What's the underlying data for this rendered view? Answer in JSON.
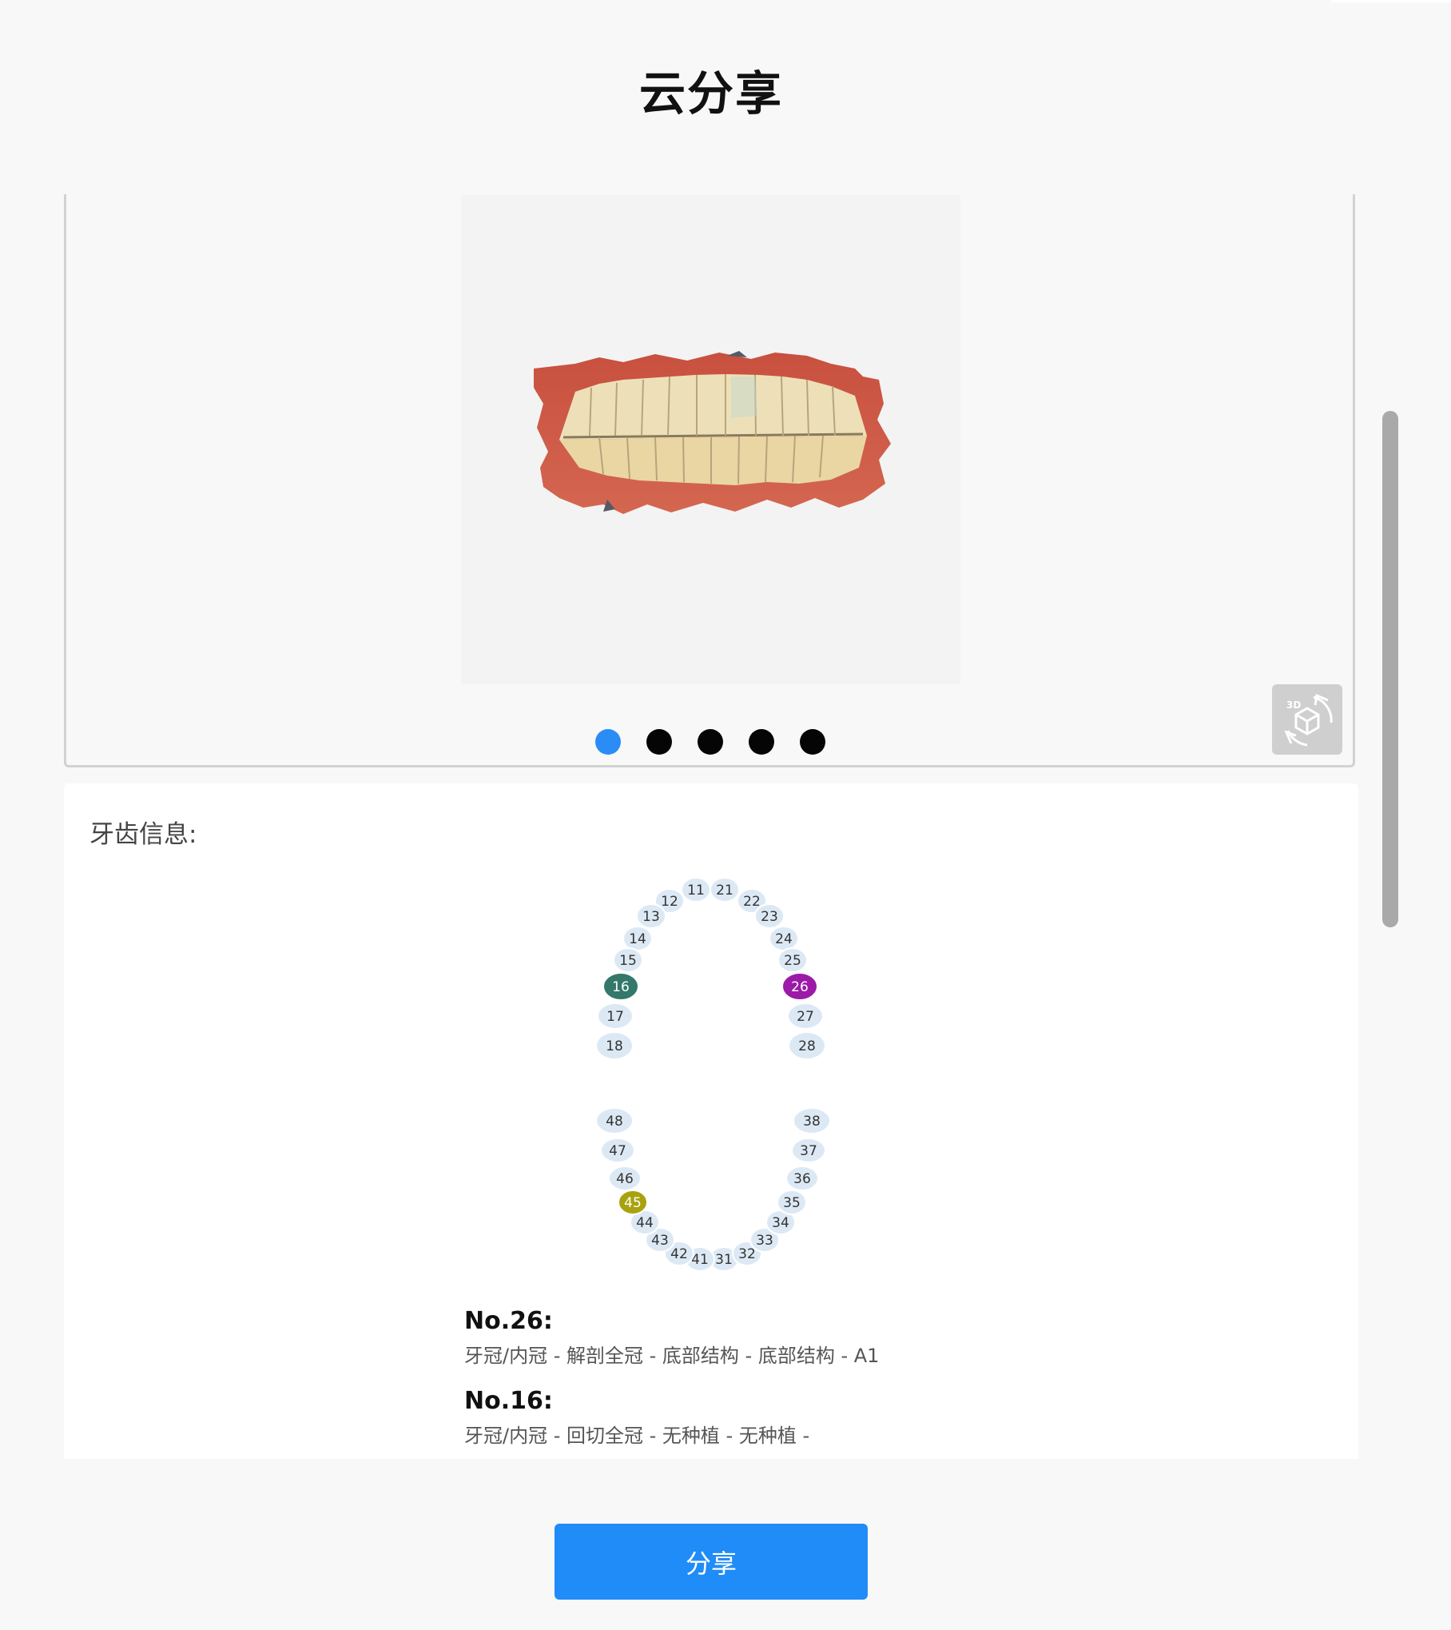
{
  "header": {
    "title": "云分享"
  },
  "viewer": {
    "dots": [
      true,
      false,
      false,
      false,
      false
    ],
    "view3d_label": "3D"
  },
  "tooth_info": {
    "label": "牙齿信息:",
    "teeth": [
      {
        "id": "11"
      },
      {
        "id": "12"
      },
      {
        "id": "13"
      },
      {
        "id": "14"
      },
      {
        "id": "15"
      },
      {
        "id": "16",
        "color": "#33786a"
      },
      {
        "id": "17"
      },
      {
        "id": "18"
      },
      {
        "id": "21"
      },
      {
        "id": "22"
      },
      {
        "id": "23"
      },
      {
        "id": "24"
      },
      {
        "id": "25"
      },
      {
        "id": "26",
        "color": "#9b1aa8"
      },
      {
        "id": "27"
      },
      {
        "id": "28"
      },
      {
        "id": "31"
      },
      {
        "id": "32"
      },
      {
        "id": "33"
      },
      {
        "id": "34"
      },
      {
        "id": "35"
      },
      {
        "id": "36"
      },
      {
        "id": "37"
      },
      {
        "id": "38"
      },
      {
        "id": "41"
      },
      {
        "id": "42"
      },
      {
        "id": "43"
      },
      {
        "id": "44"
      },
      {
        "id": "45",
        "color": "#a9a20f"
      },
      {
        "id": "46"
      },
      {
        "id": "47"
      },
      {
        "id": "48"
      }
    ],
    "details": [
      {
        "title": "No.26:",
        "text": "牙冠/内冠 - 解剖全冠 - 底部结构 - 底部结构 - A1"
      },
      {
        "title": "No.16:",
        "text": "牙冠/内冠 - 回切全冠 - 无种植 - 无种植 -"
      }
    ]
  },
  "footer": {
    "share_label": "分享"
  },
  "colors": {
    "accent": "#208cf7",
    "tooth_default": "#dce9f5"
  }
}
